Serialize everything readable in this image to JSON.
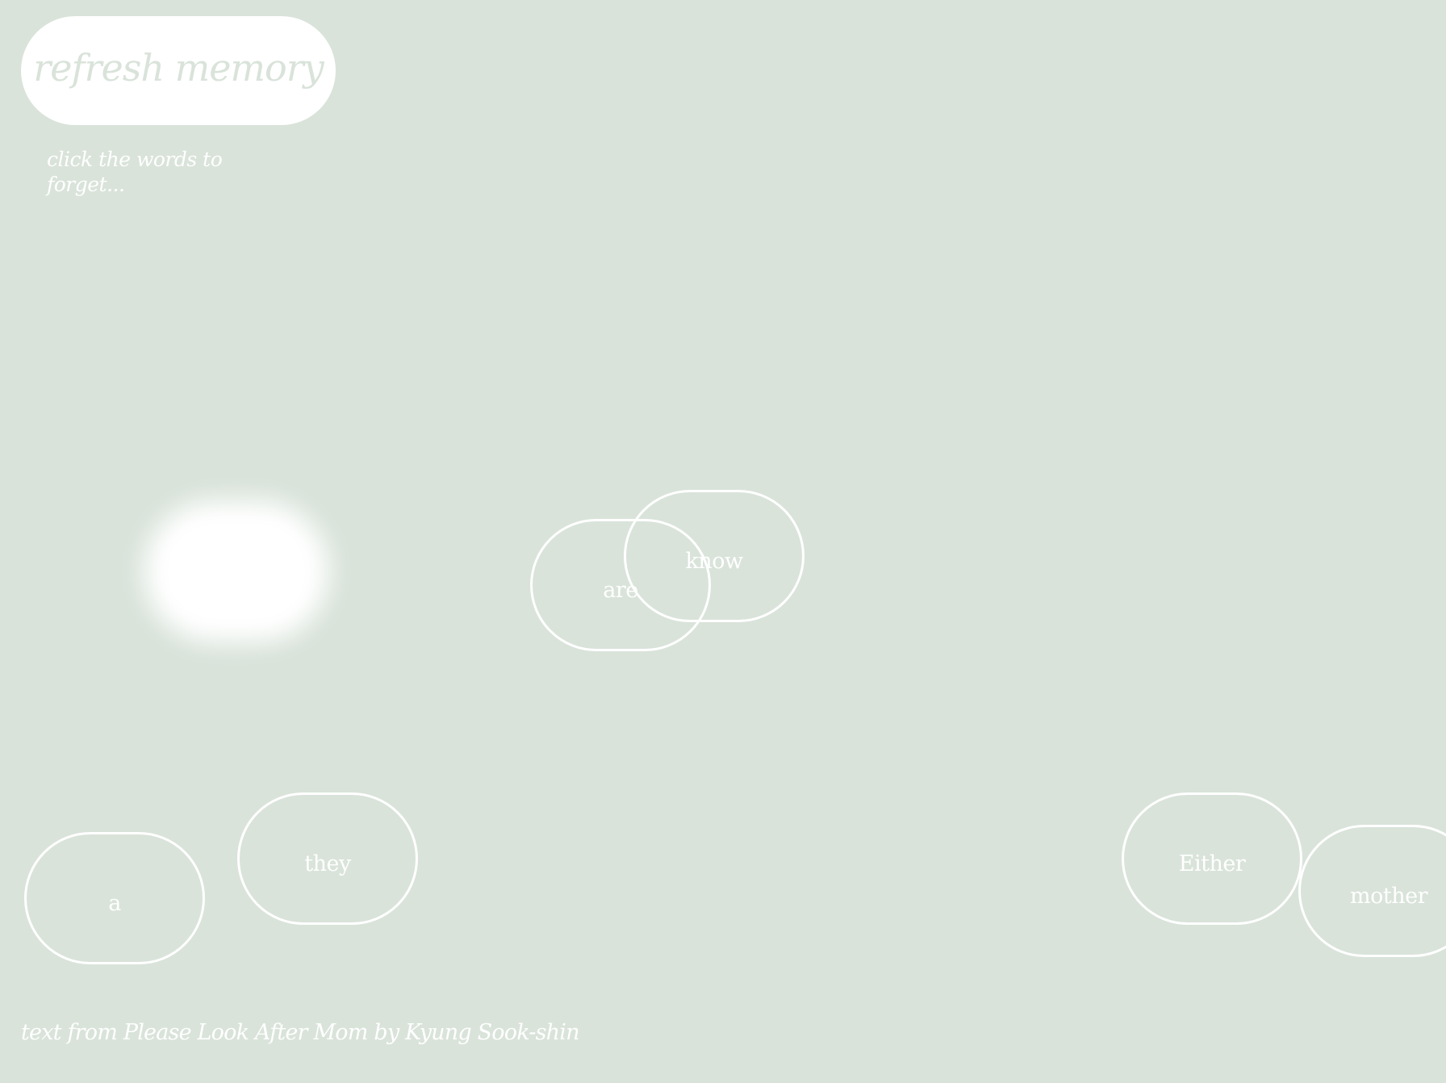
{
  "refresh_button": {
    "label": "refresh memory"
  },
  "hint": "click the words to forget...",
  "words": [
    {
      "id": "are",
      "label": "are"
    },
    {
      "id": "know",
      "label": "know"
    },
    {
      "id": "they",
      "label": "they"
    },
    {
      "id": "a",
      "label": "a"
    },
    {
      "id": "either",
      "label": "Either"
    },
    {
      "id": "mother",
      "label": "mother"
    }
  ],
  "credit": "text from Please Look After Mom by Kyung Sook-shin",
  "colors": {
    "background": "#d9e3da",
    "foreground": "#ffffff"
  }
}
